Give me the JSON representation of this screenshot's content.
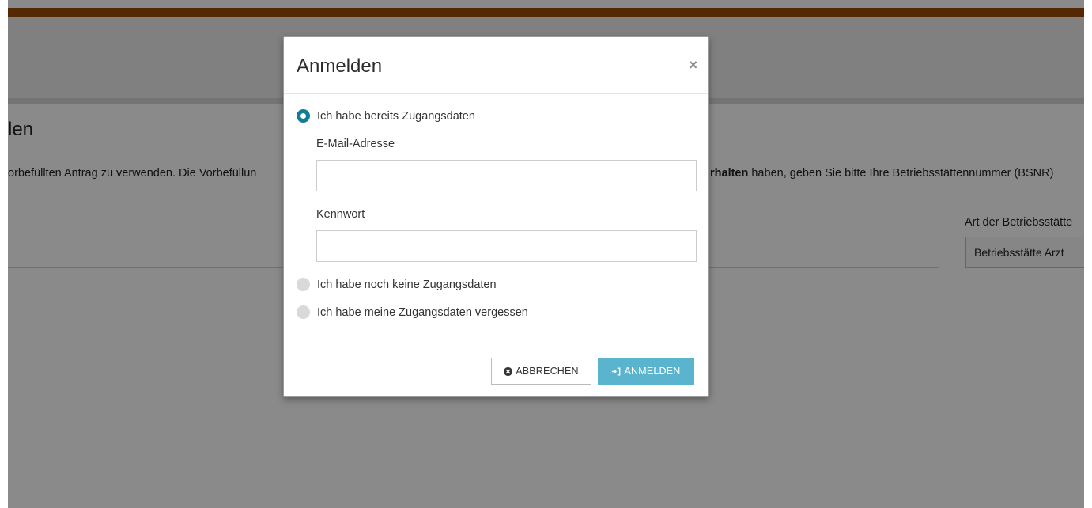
{
  "background": {
    "title": "len",
    "intro_text": "orbefüllten Antrag zu verwenden. Die Vorbefüllun",
    "intro_bold": "rhalten",
    "intro_text_right": " haben, geben Sie bitte Ihre Betriebsstättennummer (BSNR)",
    "select_label": "Art der Betriebsstätte",
    "select_value": "Betriebsstätte Arzt"
  },
  "modal": {
    "title": "Anmelden",
    "close_symbol": "×",
    "options": [
      {
        "label": "Ich habe bereits Zugangsdaten",
        "checked": true
      },
      {
        "label": "Ich habe noch keine Zugangsdaten",
        "checked": false
      },
      {
        "label": "Ich habe meine Zugangsdaten vergessen",
        "checked": false
      }
    ],
    "email_label": "E-Mail-Adresse",
    "email_value": "",
    "password_label": "Kennwort",
    "password_value": "",
    "cancel_label": "ABBRECHEN",
    "login_label": "ANMELDEN"
  },
  "colors": {
    "accent_bar": "#9c4a06",
    "radio_checked": "#0f7c9a",
    "login_button": "#5bb4ce"
  },
  "icons": {
    "cancel": "times-circle-icon",
    "login": "sign-in-icon",
    "close": "close-icon"
  }
}
